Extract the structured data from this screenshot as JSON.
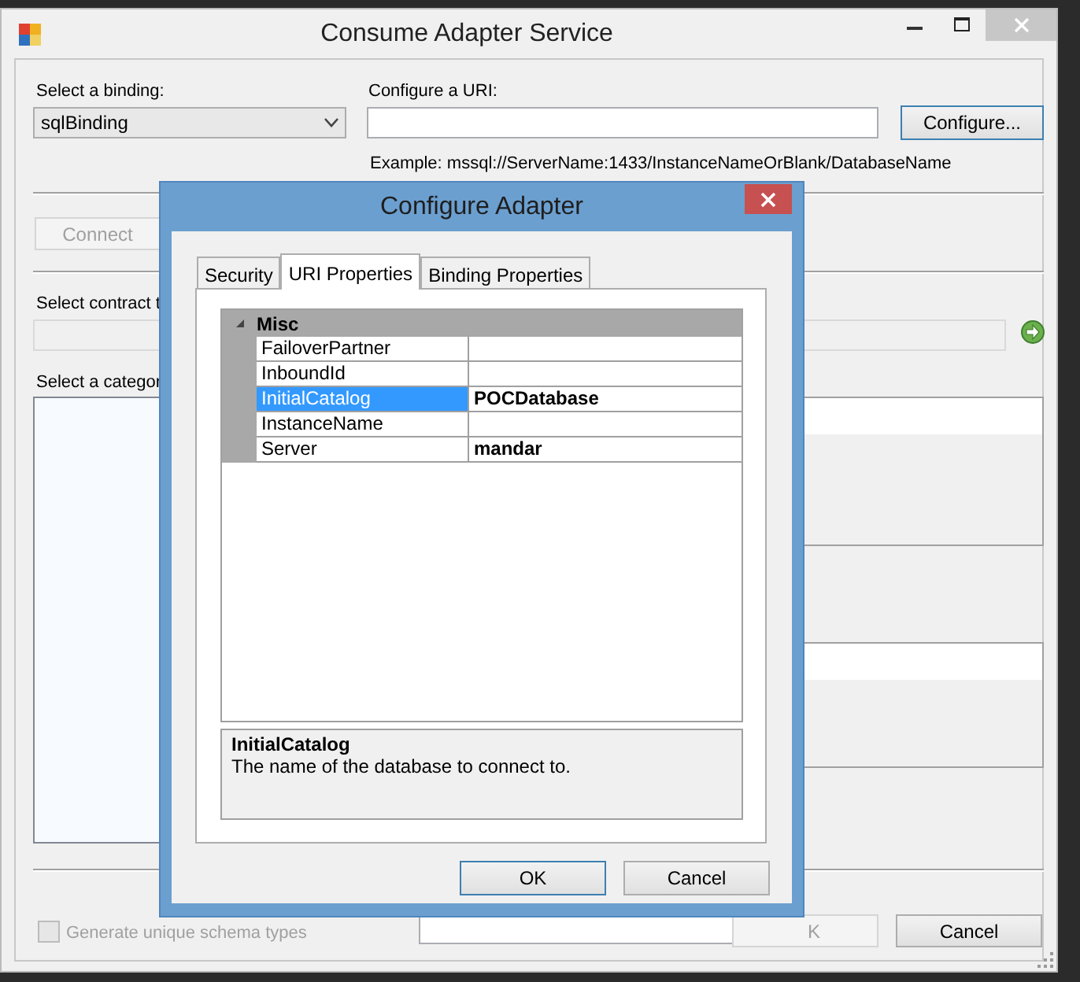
{
  "main_window": {
    "title": "Consume Adapter Service",
    "binding": {
      "label": "Select a binding:",
      "value": "sqlBinding"
    },
    "uri": {
      "label": "Configure a URI:",
      "button": "Configure...",
      "example": "Example: mssql://ServerName:1433/InstanceNameOrBlank/DatabaseName"
    },
    "connect_button": {
      "label": "Connect",
      "disabled": true
    },
    "contract": {
      "label": "Select contract t",
      "disabled": true
    },
    "category": {
      "label": "Select a categor"
    },
    "generate_checkbox": {
      "label": "Generate unique schema types",
      "checked": false,
      "disabled": true
    },
    "buttons": [
      {
        "label": "K",
        "disabled": true
      },
      {
        "label": "Cancel",
        "disabled": false
      }
    ]
  },
  "dialog": {
    "title": "Configure Adapter",
    "tabs": [
      {
        "label": "Security",
        "selected": false
      },
      {
        "label": "URI Properties",
        "selected": true
      },
      {
        "label": "Binding Properties",
        "selected": false
      }
    ],
    "property_grid": {
      "category": {
        "label": "Misc",
        "expanded": true
      },
      "rows": [
        {
          "name": "FailoverPartner",
          "selected": false
        },
        {
          "name": "InboundId",
          "selected": false
        },
        {
          "name": "InitialCatalog",
          "value": "POCDatabase",
          "selected": true
        },
        {
          "name": "InstanceName",
          "selected": false
        },
        {
          "name": "Server",
          "value": "mandar",
          "selected": false
        }
      ]
    },
    "description": {
      "title": "InitialCatalog",
      "text": "The name of the database to connect to."
    },
    "buttons": [
      {
        "label": "OK",
        "default": true
      },
      {
        "label": "Cancel",
        "default": false
      }
    ]
  }
}
